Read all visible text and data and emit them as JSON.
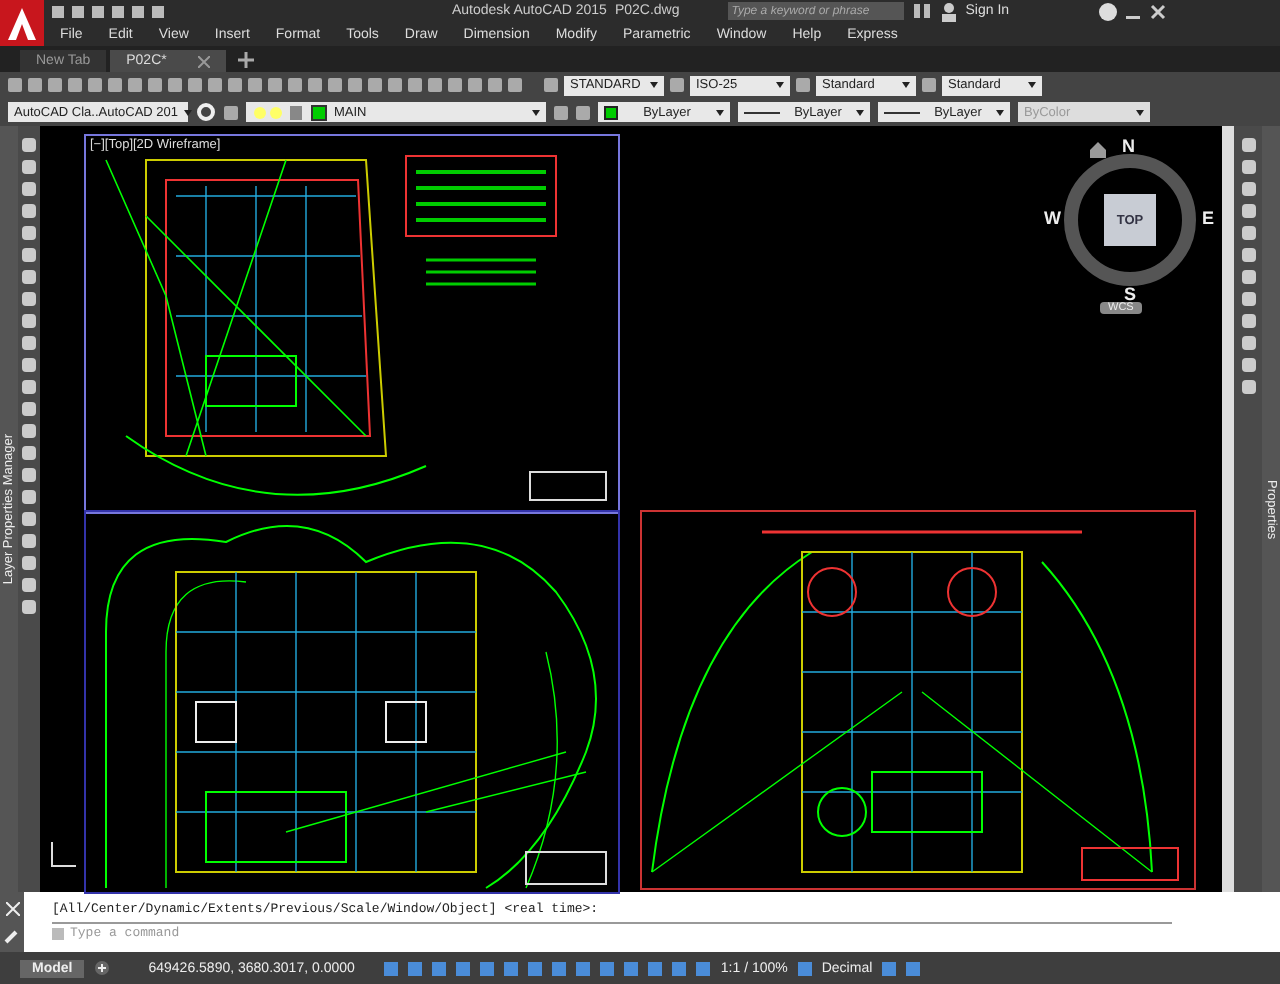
{
  "app": {
    "title": "Autodesk AutoCAD 2015",
    "file": "P02C.dwg",
    "search": {
      "placeholder": "Type a keyword or phrase"
    },
    "sign_in": "Sign In"
  },
  "menu": [
    "File",
    "Edit",
    "View",
    "Insert",
    "Format",
    "Tools",
    "Draw",
    "Dimension",
    "Modify",
    "Parametric",
    "Window",
    "Help",
    "Express"
  ],
  "tabs": [
    {
      "label": "New Tab",
      "selected": false
    },
    {
      "label": "P02C*",
      "selected": true
    }
  ],
  "styles": [
    "STANDARD",
    "ISO-25",
    "Standard",
    "Standard"
  ],
  "workspace": "AutoCAD Cla..AutoCAD 201",
  "layer": "MAIN",
  "properties": [
    {
      "label": "ByLayer",
      "disabled": false
    },
    {
      "label": "ByLayer",
      "disabled": false
    },
    {
      "label": "ByLayer",
      "disabled": false
    },
    {
      "label": "ByColor",
      "disabled": true
    }
  ],
  "palettes": {
    "left": "Layer Properties Manager",
    "right": "Properties"
  },
  "viewport_label": "[−][Top][2D Wireframe]",
  "viewcube": {
    "face": "TOP",
    "north": "N",
    "south": "S",
    "east": "E",
    "west": "W",
    "ucs": "WCS"
  },
  "command": {
    "history": "[All/Center/Dynamic/Extents/Previous/Scale/Window/Object] <real time>:",
    "placeholder": "Type a command"
  },
  "status": {
    "layout_tab": "Model",
    "coordinates": "649426.5890, 3680.3017, 0.0000",
    "scale": "1:1 / 100%",
    "units": "Decimal"
  }
}
